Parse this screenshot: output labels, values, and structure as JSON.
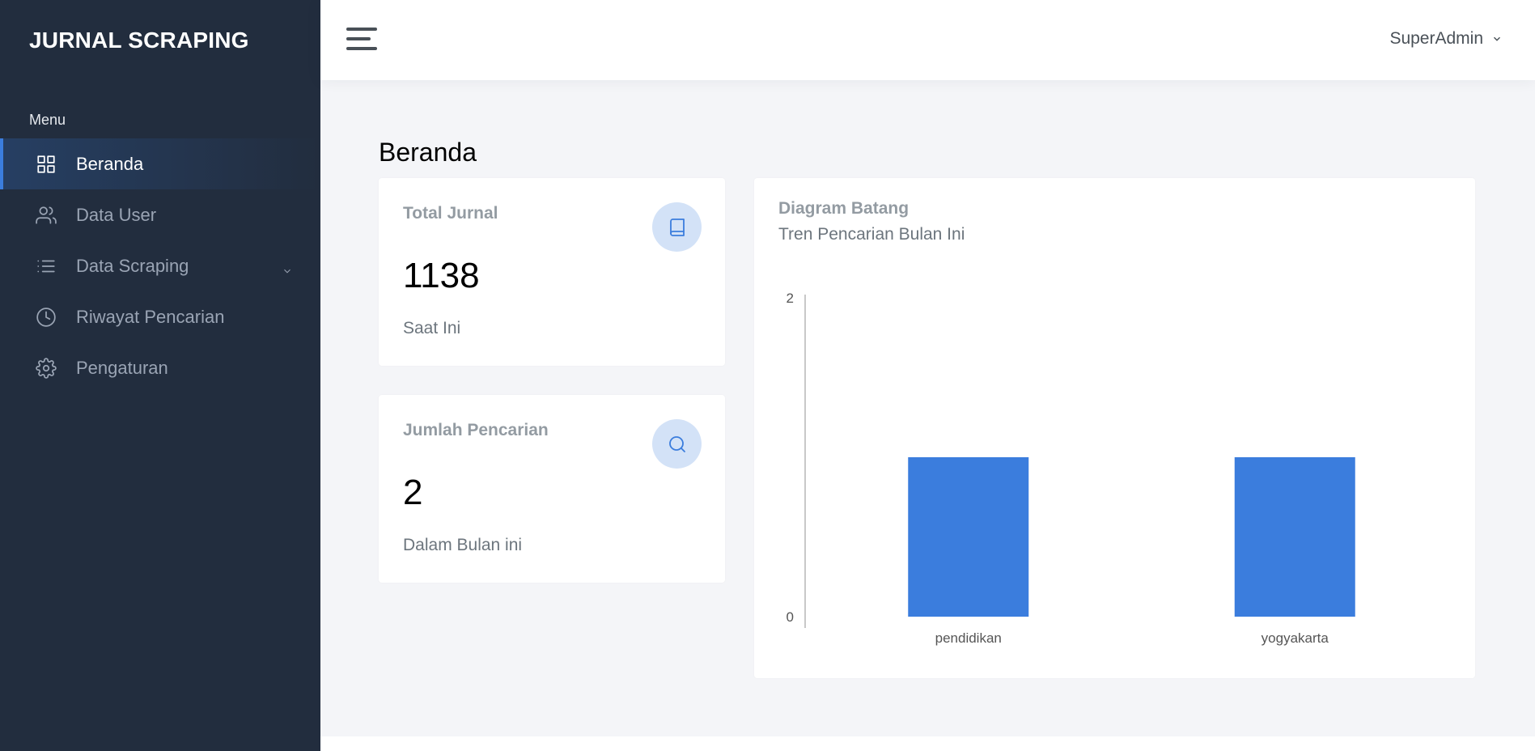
{
  "sidebar": {
    "brand": "JURNAL SCRAPING",
    "menu_label": "Menu",
    "items": [
      {
        "label": "Beranda",
        "icon": "grid-icon",
        "active": true
      },
      {
        "label": "Data User",
        "icon": "users-icon"
      },
      {
        "label": "Data Scraping",
        "icon": "list-icon",
        "has_submenu": true
      },
      {
        "label": "Riwayat Pencarian",
        "icon": "clock-icon"
      },
      {
        "label": "Pengaturan",
        "icon": "gear-icon"
      }
    ]
  },
  "topbar": {
    "user": "SuperAdmin"
  },
  "main": {
    "title": "Beranda",
    "stats": [
      {
        "title": "Total Jurnal",
        "value": "1138",
        "sub": "Saat Ini",
        "icon": "book-icon"
      },
      {
        "title": "Jumlah Pencarian",
        "value": "2",
        "sub": "Dalam Bulan ini",
        "icon": "search-icon"
      }
    ],
    "chart_card": {
      "title": "Diagram Batang",
      "subtitle": "Tren Pencarian Bulan Ini"
    }
  },
  "colors": {
    "sidebar_bg": "#222d3e",
    "accent": "#3b7ddd",
    "bar": "#3b7ddd",
    "page_bg": "#f4f5f8"
  },
  "chart_data": {
    "type": "bar",
    "categories": [
      "pendidikan",
      "yogyakarta"
    ],
    "values": [
      1,
      1
    ],
    "yticks": [
      "0",
      "2"
    ],
    "ylim": [
      0,
      2
    ],
    "grid": false,
    "legend": "none"
  }
}
